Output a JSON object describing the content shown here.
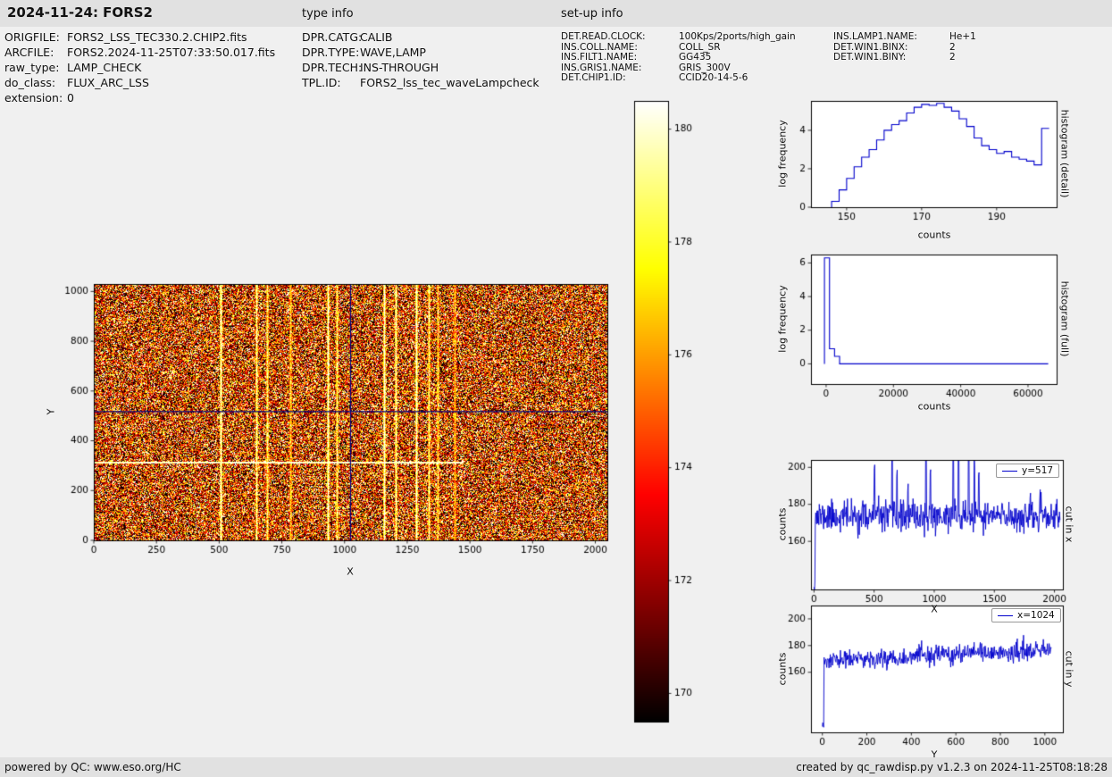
{
  "header": {
    "title": "2024-11-24: FORS2",
    "type_info_label": "type info",
    "setup_info_label": "set-up info"
  },
  "file_info": {
    "rows": [
      {
        "label": "ORIGFILE:",
        "value": "FORS2_LSS_TEC330.2.CHIP2.fits"
      },
      {
        "label": "ARCFILE:",
        "value": "FORS2.2024-11-25T07:33:50.017.fits"
      },
      {
        "label": "raw_type:",
        "value": "LAMP_CHECK"
      },
      {
        "label": "do_class:",
        "value": "FLUX_ARC_LSS"
      },
      {
        "label": "extension:",
        "value": "0"
      }
    ]
  },
  "type_info": {
    "rows": [
      {
        "label": "DPR.CATG:",
        "value": "CALIB"
      },
      {
        "label": "DPR.TYPE:",
        "value": "WAVE,LAMP"
      },
      {
        "label": "DPR.TECH:",
        "value": "INS-THROUGH"
      },
      {
        "label": "TPL.ID:",
        "value": "FORS2_lss_tec_waveLampcheck"
      }
    ]
  },
  "setup_info": {
    "col1": [
      {
        "label": "DET.READ.CLOCK:",
        "value": "100Kps/2ports/high_gain"
      },
      {
        "label": "INS.COLL.NAME:",
        "value": "COLL_SR"
      },
      {
        "label": "INS.FILT1.NAME:",
        "value": "GG435"
      },
      {
        "label": "INS.GRIS1.NAME:",
        "value": "GRIS_300V"
      },
      {
        "label": "DET.CHIP1.ID:",
        "value": "CCID20-14-5-6"
      }
    ],
    "col2": [
      {
        "label": "INS.LAMP1.NAME:",
        "value": "He+1"
      },
      {
        "label": "DET.WIN1.BINX:",
        "value": "2"
      },
      {
        "label": "DET.WIN1.BINY:",
        "value": "2"
      }
    ]
  },
  "footer": {
    "left": "powered by QC: www.eso.org/HC",
    "right": "created by qc_rawdisp.py v1.2.3 on 2024-11-25T08:18:28"
  },
  "chart_data": [
    {
      "type": "heatmap",
      "name": "raw-image",
      "xlabel": "X",
      "ylabel": "Y",
      "xlim": [
        0,
        2048
      ],
      "ylim": [
        0,
        1030
      ],
      "xticks": [
        0,
        250,
        500,
        750,
        1000,
        1250,
        1500,
        1750,
        2000
      ],
      "yticks": [
        0,
        200,
        400,
        600,
        800,
        1000
      ],
      "colormap": "hot",
      "value_range": [
        169.5,
        180.5
      ],
      "noise_mean": 174,
      "noise_sigma": 4.2,
      "seed": 42,
      "emission_lines": [
        {
          "x": 505,
          "amp": 7
        },
        {
          "x": 648,
          "amp": 6
        },
        {
          "x": 691,
          "amp": 5
        },
        {
          "x": 783,
          "amp": 3.5
        },
        {
          "x": 933,
          "amp": 7
        },
        {
          "x": 969,
          "amp": 5
        },
        {
          "x": 1157,
          "amp": 7
        },
        {
          "x": 1204,
          "amp": 6
        },
        {
          "x": 1285,
          "amp": 7
        },
        {
          "x": 1335,
          "amp": 5
        },
        {
          "x": 1371,
          "amp": 4
        },
        {
          "x": 1440,
          "amp": 3
        }
      ],
      "bright_row": {
        "y": 312,
        "x_end": 1470
      },
      "cut_row_y": 517,
      "cut_col_x": 1024,
      "marker_color": "#000080"
    },
    {
      "type": "colorbar",
      "colormap": "hot",
      "range": [
        169.5,
        180.5
      ],
      "ticks": [
        170,
        172,
        174,
        176,
        178,
        180
      ]
    },
    {
      "type": "bar",
      "name": "histogram-detail",
      "right_label": "histogram (detail)",
      "xlabel": "counts",
      "ylabel": "log frequency",
      "line_color": "#0000cc",
      "xlim": [
        140.5,
        206
      ],
      "ylim": [
        0,
        5.53
      ],
      "xticks": [
        150,
        170,
        190
      ],
      "yticks": [
        0,
        2,
        4
      ],
      "bin_edges": [
        146,
        148,
        150,
        152,
        154,
        156,
        158,
        160,
        162,
        164,
        166,
        168,
        170,
        172,
        174,
        176,
        178,
        180,
        182,
        184,
        186,
        188,
        190,
        192,
        194,
        196,
        198,
        200,
        202,
        204
      ],
      "log_freq": [
        0.3,
        0.9,
        1.5,
        2.1,
        2.6,
        3.0,
        3.5,
        4.0,
        4.3,
        4.5,
        4.9,
        5.2,
        5.35,
        5.3,
        5.4,
        5.2,
        5.0,
        4.6,
        4.2,
        3.6,
        3.2,
        3.0,
        2.8,
        2.9,
        2.6,
        2.5,
        2.4,
        2.2,
        4.1
      ]
    },
    {
      "type": "bar",
      "name": "histogram-full",
      "right_label": "histogram (full)",
      "xlabel": "counts",
      "ylabel": "log frequency",
      "line_color": "#0000cc",
      "xlim": [
        -4500,
        68500
      ],
      "ylim": [
        -1.2,
        6.5
      ],
      "xticks": [
        0,
        20000,
        40000,
        60000
      ],
      "yticks": [
        0,
        2,
        4,
        6
      ],
      "bin_edges": [
        -500,
        1000,
        2500,
        4000,
        66000
      ],
      "log_freq": [
        6.3,
        0.9,
        0.45,
        0
      ]
    },
    {
      "type": "line",
      "name": "cut-in-x",
      "legend": "y=517",
      "right_label": "cut in x",
      "xlabel": "X",
      "ylabel": "counts",
      "line_color": "#0000cc",
      "xlim": [
        -25,
        2070
      ],
      "ylim": [
        134,
        204
      ],
      "xticks": [
        0,
        500,
        1000,
        1500,
        2000
      ],
      "yticks": [
        160,
        180,
        200
      ],
      "data_range": [
        0,
        2046
      ],
      "n_points": 560,
      "baseline": 173.5,
      "noise_sigma": 4.2,
      "seed": 11,
      "dip": {
        "x_max": 8,
        "v": 137
      },
      "spikes": [
        {
          "x": 505,
          "v": 200
        },
        {
          "x": 648,
          "v": 207
        },
        {
          "x": 691,
          "v": 196
        },
        {
          "x": 783,
          "v": 187
        },
        {
          "x": 933,
          "v": 213
        },
        {
          "x": 969,
          "v": 198
        },
        {
          "x": 1157,
          "v": 212
        },
        {
          "x": 1204,
          "v": 215
        },
        {
          "x": 1285,
          "v": 216
        },
        {
          "x": 1335,
          "v": 205
        },
        {
          "x": 1371,
          "v": 193
        }
      ]
    },
    {
      "type": "line",
      "name": "cut-in-y",
      "legend": "x=1024",
      "right_label": "cut in y",
      "xlabel": "Y",
      "ylabel": "counts",
      "line_color": "#0000cc",
      "xlim": [
        -51,
        1081
      ],
      "ylim": [
        115,
        210
      ],
      "xticks": [
        0,
        200,
        400,
        600,
        800,
        1000
      ],
      "yticks": [
        160,
        180,
        200
      ],
      "data_range": [
        0,
        1029
      ],
      "n_points": 520,
      "trend": [
        168.5,
        176.5
      ],
      "noise_sigma": 3.6,
      "seed": 23,
      "dip": {
        "x_max": 6,
        "v": 120
      },
      "spikes": []
    }
  ]
}
